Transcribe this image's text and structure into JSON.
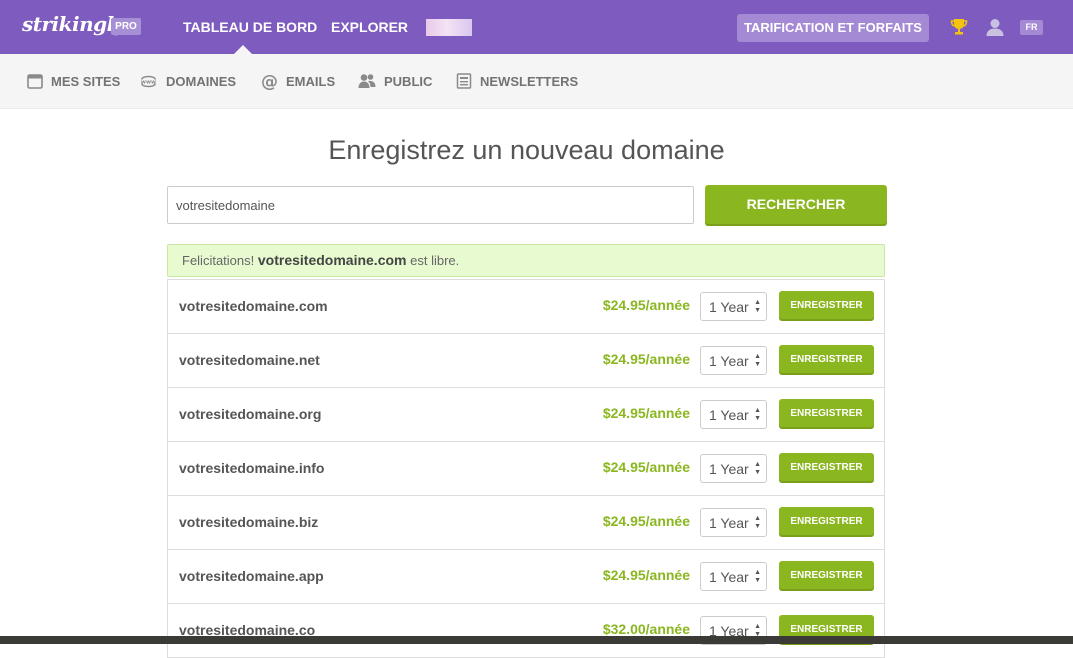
{
  "header": {
    "logo": "strikingly",
    "badge": "PRO",
    "nav": [
      {
        "label": "TABLEAU DE BORD"
      },
      {
        "label": "EXPLORER"
      }
    ],
    "pricing_label": "TARIFICATION ET FORFAITS",
    "language": "FR",
    "icons": [
      "trophy-icon",
      "user-icon"
    ],
    "accent_color": "#7e5bbf"
  },
  "subnav": {
    "items": [
      {
        "label": "MES SITES",
        "icon": "browser-window-icon"
      },
      {
        "label": "DOMAINES",
        "icon": "www-icon"
      },
      {
        "label": "EMAILS",
        "icon": "at-icon"
      },
      {
        "label": "PUBLIC",
        "icon": "people-icon"
      },
      {
        "label": "NEWSLETTERS",
        "icon": "newsletter-icon"
      }
    ]
  },
  "main": {
    "title": "Enregistrez un nouveau domaine",
    "search_value": "votresitedomaine",
    "search_button": "RECHERCHER",
    "alert": {
      "prefix": "Felicitations!",
      "domain": "votresitedomaine.com",
      "suffix": "est libre."
    },
    "results": [
      {
        "domain": "votresitedomaine.com",
        "price": "$24.95/année",
        "term": "1 Year",
        "button": "ENREGISTRER"
      },
      {
        "domain": "votresitedomaine.net",
        "price": "$24.95/année",
        "term": "1 Year",
        "button": "ENREGISTRER"
      },
      {
        "domain": "votresitedomaine.org",
        "price": "$24.95/année",
        "term": "1 Year",
        "button": "ENREGISTRER"
      },
      {
        "domain": "votresitedomaine.info",
        "price": "$24.95/année",
        "term": "1 Year",
        "button": "ENREGISTRER"
      },
      {
        "domain": "votresitedomaine.biz",
        "price": "$24.95/année",
        "term": "1 Year",
        "button": "ENREGISTRER"
      },
      {
        "domain": "votresitedomaine.app",
        "price": "$24.95/année",
        "term": "1 Year",
        "button": "ENREGISTRER"
      },
      {
        "domain": "votresitedomaine.co",
        "price": "$32.00/année",
        "term": "1 Year",
        "button": "ENREGISTRER"
      }
    ],
    "button_color": "#8ab61f"
  }
}
